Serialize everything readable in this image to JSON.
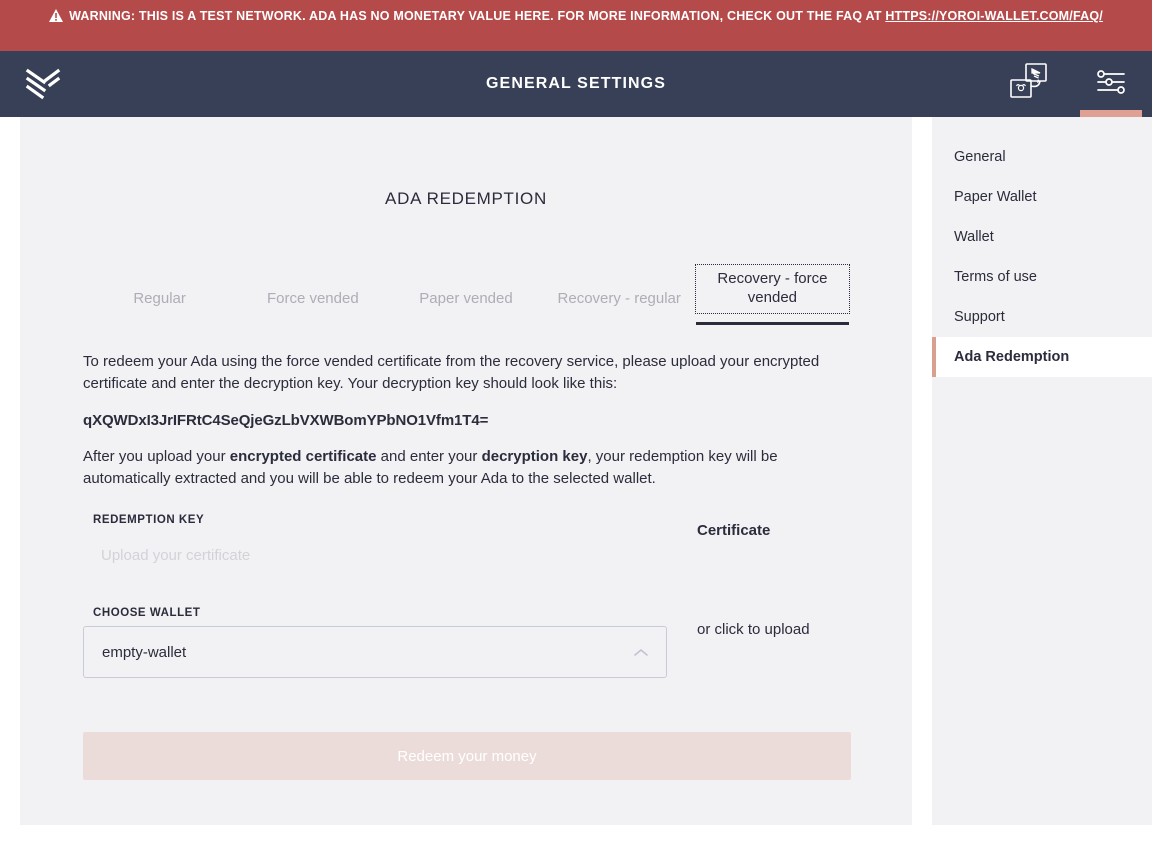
{
  "warning": {
    "icon": "warning-triangle-icon",
    "text_before": "WARNING: THIS IS A TEST NETWORK. ADA HAS NO MONETARY VALUE HERE. FOR MORE INFORMATION, CHECK OUT THE FAQ AT ",
    "link_text": "HTTPS://YOROI-WALLET.COM/FAQ/",
    "background_color": "#b54a4a",
    "text_color": "#ffffff"
  },
  "topbar": {
    "logo_name": "yoroi-logo",
    "title": "GENERAL SETTINGS",
    "background_color": "#384057",
    "actions": [
      {
        "name": "wallet-switch-icon",
        "active": false
      },
      {
        "name": "settings-sliders-icon",
        "active": true
      }
    ],
    "active_indicator_color": "#dfa193"
  },
  "settings_menu": {
    "items": [
      {
        "label": "General",
        "active": false
      },
      {
        "label": "Paper Wallet",
        "active": false
      },
      {
        "label": "Wallet",
        "active": false
      },
      {
        "label": "Terms of use",
        "active": false
      },
      {
        "label": "Support",
        "active": false
      },
      {
        "label": "Ada Redemption",
        "active": true
      }
    ],
    "active_accent_color": "#d9a08f"
  },
  "main": {
    "title": "ADA REDEMPTION",
    "tabs": [
      {
        "label": "Regular",
        "active": false
      },
      {
        "label": "Force vended",
        "active": false
      },
      {
        "label": "Paper vended",
        "active": false
      },
      {
        "label": "Recovery - regular",
        "active": false
      },
      {
        "label": "Recovery - force vended",
        "active": true
      }
    ],
    "instructions": {
      "paragraph_1": "To redeem your Ada using the force vended certificate from the recovery service, please upload your encrypted certificate and enter the decryption key. Your decryption key should look like this:",
      "example_key": "qXQWDxI3JrIFRtC4SeQjeGzLbVXWBomYPbNO1Vfm1T4=",
      "paragraph_2_part_1": "After you upload your ",
      "paragraph_2_bold_1": "encrypted certificate",
      "paragraph_2_part_2": " and enter your ",
      "paragraph_2_bold_2": "decryption key",
      "paragraph_2_part_3": ", your redemption key will be automatically extracted and you will be able to redeem your Ada to the selected wallet."
    },
    "form": {
      "redemption_key_label": "REDEMPTION KEY",
      "redemption_key_value": "",
      "redemption_key_placeholder": "Upload your certificate",
      "choose_wallet_label": "CHOOSE WALLET",
      "choose_wallet_value": "empty-wallet",
      "choose_wallet_chevron": "chevron-up-icon",
      "certificate_title": "Certificate",
      "certificate_upload_text": "or click to upload",
      "submit_label": "Redeem your money",
      "submit_disabled": true,
      "submit_color": "#ecdcd9"
    }
  }
}
